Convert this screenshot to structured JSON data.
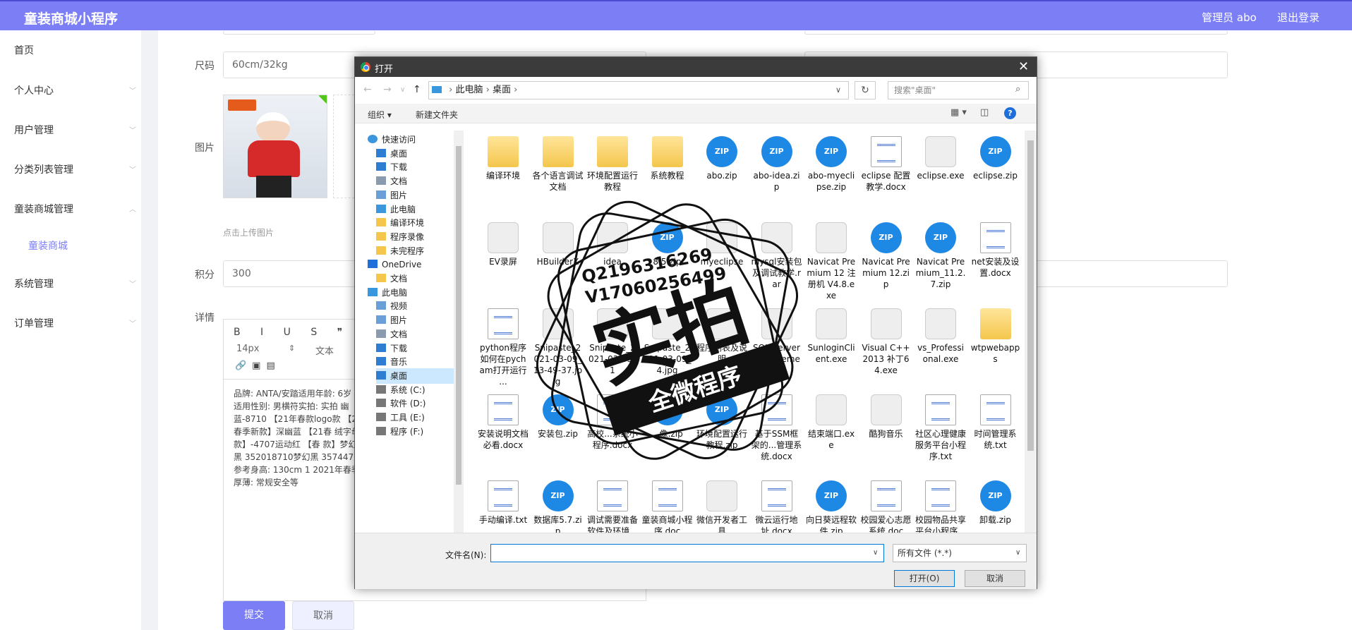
{
  "app": {
    "title": "童装商城小程序",
    "admin": "管理员 abo",
    "logout": "退出登录"
  },
  "sidebar": {
    "items": [
      {
        "label": "首页"
      },
      {
        "label": "个人中心"
      },
      {
        "label": "用户管理"
      },
      {
        "label": "分类列表管理"
      },
      {
        "label": "童装商城管理"
      },
      {
        "label": "童装商城"
      },
      {
        "label": "系统管理"
      },
      {
        "label": "订单管理"
      }
    ]
  },
  "form": {
    "size_label": "尺码",
    "size_value": "60cm/32kg",
    "image_label": "图片",
    "upload_hint": "点击上传图片",
    "points_label": "积分",
    "points_value": "300",
    "detail_label": "详情",
    "font_size": "14px",
    "paragraph": "文本",
    "detail_text": "品牌: ANTA/安踏适用年龄: 6岁 动适用性别: 男横符实拍: 实拍 幽蓝-8710 【21年春款logo款 【21春季新款】深幽蓝 【21春 绒字母款】-4707运动红 【春 款】梦幻黑 352018710梦幻黑 35744712参考身高: 130cm 1 2021年春季厚薄: 常规安全等",
    "submit": "提交",
    "cancel": "取消"
  },
  "dialog": {
    "title": "打开",
    "path": [
      "此电脑",
      "桌面"
    ],
    "search_placeholder": "搜索\"桌面\"",
    "organize": "组织 ▾",
    "new_folder": "新建文件夹",
    "tree": [
      {
        "label": "快速访问",
        "icon": "star"
      },
      {
        "label": "桌面",
        "icon": "desktop"
      },
      {
        "label": "下载",
        "icon": "download"
      },
      {
        "label": "文档",
        "icon": "document"
      },
      {
        "label": "图片",
        "icon": "picture"
      },
      {
        "label": "此电脑",
        "icon": "computer"
      },
      {
        "label": "编译环境",
        "icon": "folder"
      },
      {
        "label": "程序录像",
        "icon": "folder"
      },
      {
        "label": "未完程序",
        "icon": "folder"
      },
      {
        "label": "OneDrive",
        "icon": "cloud"
      },
      {
        "label": "文档",
        "icon": "folder"
      },
      {
        "label": "此电脑",
        "icon": "computer"
      },
      {
        "label": "视频",
        "icon": "video"
      },
      {
        "label": "图片",
        "icon": "picture"
      },
      {
        "label": "文档",
        "icon": "document"
      },
      {
        "label": "下载",
        "icon": "download"
      },
      {
        "label": "音乐",
        "icon": "music"
      },
      {
        "label": "桌面",
        "icon": "desktop"
      },
      {
        "label": "系统 (C:)",
        "icon": "drive"
      },
      {
        "label": "软件 (D:)",
        "icon": "drive"
      },
      {
        "label": "工具 (E:)",
        "icon": "drive"
      },
      {
        "label": "程序 (F:)",
        "icon": "drive"
      }
    ],
    "files": [
      {
        "name": "编译环境",
        "type": "folder"
      },
      {
        "name": "各个语言调试文档",
        "type": "folder"
      },
      {
        "name": "环境配置运行教程",
        "type": "folder"
      },
      {
        "name": "系统教程",
        "type": "folder"
      },
      {
        "name": "abo.zip",
        "type": "zip"
      },
      {
        "name": "abo-idea.zip",
        "type": "zip"
      },
      {
        "name": "abo-myeclipse.zip",
        "type": "zip"
      },
      {
        "name": "eclipse 配置教学.docx",
        "type": "doc"
      },
      {
        "name": "eclipse.exe",
        "type": "exe"
      },
      {
        "name": "eclipse.zip",
        "type": "zip"
      },
      {
        "name": "EV录屏",
        "type": "exe"
      },
      {
        "name": "HBuilderX",
        "type": "exe"
      },
      {
        "name": "idea",
        "type": "exe"
      },
      {
        "name": "8.5.zip",
        "type": "zip"
      },
      {
        "name": "myeclipse",
        "type": "exe"
      },
      {
        "name": "mysql安装包及调试教学.rar",
        "type": "exe"
      },
      {
        "name": "Navicat Premium 12 注册机 V4.8.exe",
        "type": "exe"
      },
      {
        "name": "Navicat Premium 12.zip",
        "type": "zip"
      },
      {
        "name": "Navicat Premium_11.2.7.zip",
        "type": "zip"
      },
      {
        "name": "net安装及设置.docx",
        "type": "doc"
      },
      {
        "name": "python程序如何在pycham打开运行 ...",
        "type": "doc"
      },
      {
        "name": "Snipaste_2021-03-09_13-49-37.jpg",
        "type": "exe"
      },
      {
        "name": "Snipaste_2021-03-09_1",
        "type": "exe"
      },
      {
        "name": "Snipaste_2021-03-09_4.jpg",
        "type": "exe"
      },
      {
        "name": "程序测表及说明",
        "type": "exe"
      },
      {
        "name": "SQL Server Management",
        "type": "exe"
      },
      {
        "name": "SunloginClient.exe",
        "type": "exe"
      },
      {
        "name": "Visual C++2013 补丁64.exe",
        "type": "exe"
      },
      {
        "name": "vs_Professional.exe",
        "type": "exe"
      },
      {
        "name": "wtpwebapps",
        "type": "folder"
      },
      {
        "name": "安装说明文档必看.docx",
        "type": "doc"
      },
      {
        "name": "安装包.zip",
        "type": "zip"
      },
      {
        "name": "高校...系统小程序.docx",
        "type": "doc"
      },
      {
        "name": "...像.zip",
        "type": "zip"
      },
      {
        "name": "环境配置运行教程.zip",
        "type": "zip"
      },
      {
        "name": "基于SSM框架的...管理系统.docx",
        "type": "doc"
      },
      {
        "name": "结束端口.exe",
        "type": "exe"
      },
      {
        "name": "酷狗音乐",
        "type": "exe"
      },
      {
        "name": "社区心理健康服务平台小程序.txt",
        "type": "doc"
      },
      {
        "name": "时间管理系统.txt",
        "type": "doc"
      },
      {
        "name": "手动编译.txt",
        "type": "doc"
      },
      {
        "name": "数据库5.7.zip",
        "type": "zip"
      },
      {
        "name": "调试需要准备软件及环境...",
        "type": "doc"
      },
      {
        "name": "童装商城小程序.doc",
        "type": "doc"
      },
      {
        "name": "微信开发者工具",
        "type": "exe"
      },
      {
        "name": "微云运行地址.docx",
        "type": "doc"
      },
      {
        "name": "向日葵远程软件.zip",
        "type": "zip"
      },
      {
        "name": "校园爱心志愿系统.doc",
        "type": "doc"
      },
      {
        "name": "校园物品共享平台小程序...",
        "type": "doc"
      },
      {
        "name": "卸载.zip",
        "type": "zip"
      }
    ],
    "filename_label": "文件名(N):",
    "filename_value": "",
    "filter": "所有文件 (*.*)",
    "open": "打开(O)",
    "cancel": "取消"
  },
  "watermark": {
    "line1": "Q2196316269",
    "line2": "V17060256499",
    "main": "实拍",
    "sub": "全微程序"
  },
  "colors": {
    "topbar": "#7b7ef5",
    "accent": "#7b7ef5",
    "zip": "#1e88e5"
  }
}
